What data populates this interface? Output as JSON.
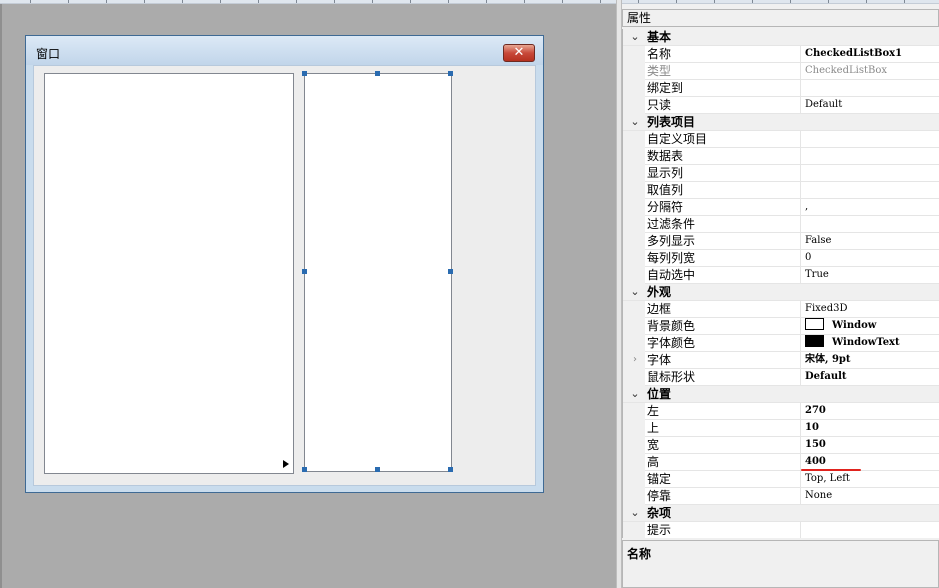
{
  "designer": {
    "window_title": "窗口",
    "close_glyph": "✕"
  },
  "properties": {
    "panel_title": "属性",
    "categories": [
      {
        "name": "基本",
        "rows": [
          {
            "name": "名称",
            "value": "CheckedListBox1",
            "bold": true
          },
          {
            "name": "类型",
            "value": "CheckedListBox",
            "gray": true
          },
          {
            "name": "绑定到",
            "value": ""
          },
          {
            "name": "只读",
            "value": "Default"
          }
        ]
      },
      {
        "name": "列表项目",
        "rows": [
          {
            "name": "自定义项目",
            "value": ""
          },
          {
            "name": "数据表",
            "value": ""
          },
          {
            "name": "显示列",
            "value": ""
          },
          {
            "name": "取值列",
            "value": ""
          },
          {
            "name": "分隔符",
            "value": ","
          },
          {
            "name": "过滤条件",
            "value": ""
          },
          {
            "name": "多列显示",
            "value": "False"
          },
          {
            "name": "每列列宽",
            "value": "0"
          },
          {
            "name": "自动选中",
            "value": "True"
          }
        ]
      },
      {
        "name": "外观",
        "rows": [
          {
            "name": "边框",
            "value": "Fixed3D"
          },
          {
            "name": "背景颜色",
            "value": "Window",
            "bold": true,
            "swatch": "#ffffff"
          },
          {
            "name": "字体颜色",
            "value": "WindowText",
            "bold": true,
            "swatch": "#000000"
          },
          {
            "name": "字体",
            "value": "宋体, 9pt",
            "bold": true,
            "expandable": true
          },
          {
            "name": "鼠标形状",
            "value": "Default",
            "bold": true
          }
        ]
      },
      {
        "name": "位置",
        "rows": [
          {
            "name": "左",
            "value": "270",
            "bold": true
          },
          {
            "name": "上",
            "value": "10",
            "bold": true
          },
          {
            "name": "宽",
            "value": "150",
            "bold": true
          },
          {
            "name": "高",
            "value": "400",
            "bold": true,
            "underline": true
          },
          {
            "name": "锚定",
            "value": "Top, Left"
          },
          {
            "name": "停靠",
            "value": "None"
          }
        ]
      },
      {
        "name": "杂项",
        "rows": [
          {
            "name": "提示",
            "value": ""
          }
        ]
      }
    ],
    "description_title": "名称"
  },
  "colors": {
    "canvas": "#ababab",
    "selection_handle": "#2a6bb0",
    "underline": "#e0231e"
  }
}
